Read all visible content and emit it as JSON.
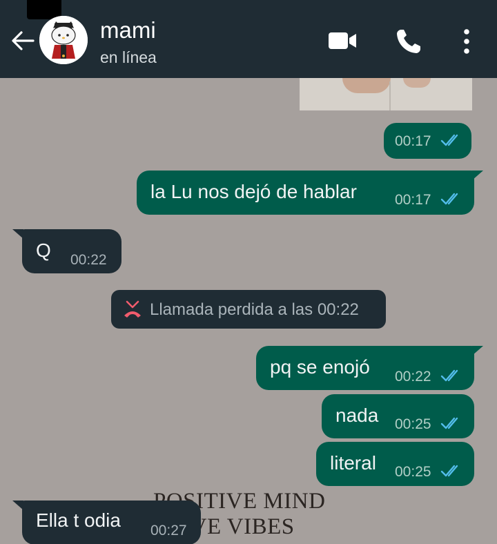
{
  "header": {
    "contact_name": "mami",
    "contact_status": "en línea",
    "icons": [
      "back-arrow-icon",
      "video-call-icon",
      "voice-call-icon",
      "more-options-icon"
    ]
  },
  "wallpaper": {
    "line1": "POSITIVE MIND",
    "line2": "ITIVE VIBES"
  },
  "messages": [
    {
      "direction": "outgoing",
      "text": "",
      "time": "00:17",
      "status": "read"
    },
    {
      "direction": "outgoing",
      "text": "la Lu nos dejó de hablar",
      "time": "00:17",
      "status": "read"
    },
    {
      "direction": "incoming",
      "text": "Q",
      "time": "00:22"
    },
    {
      "direction": "outgoing",
      "text": "pq se enojó",
      "time": "00:22",
      "status": "read"
    },
    {
      "direction": "outgoing",
      "text": "nada",
      "time": "00:25",
      "status": "read"
    },
    {
      "direction": "outgoing",
      "text": "literal",
      "time": "00:25",
      "status": "read"
    },
    {
      "direction": "incoming",
      "text": "Ella t odia",
      "time": "00:27"
    }
  ],
  "system_message": {
    "text": "Llamada perdida a las 00:22",
    "icon": "missed-call-icon"
  },
  "colors": {
    "header_bg": "#1f2c34",
    "outgoing_bubble": "#005c4b",
    "incoming_bubble": "#1f2c34",
    "read_ticks": "#53bdeb",
    "missed_call": "#f15c6d"
  }
}
